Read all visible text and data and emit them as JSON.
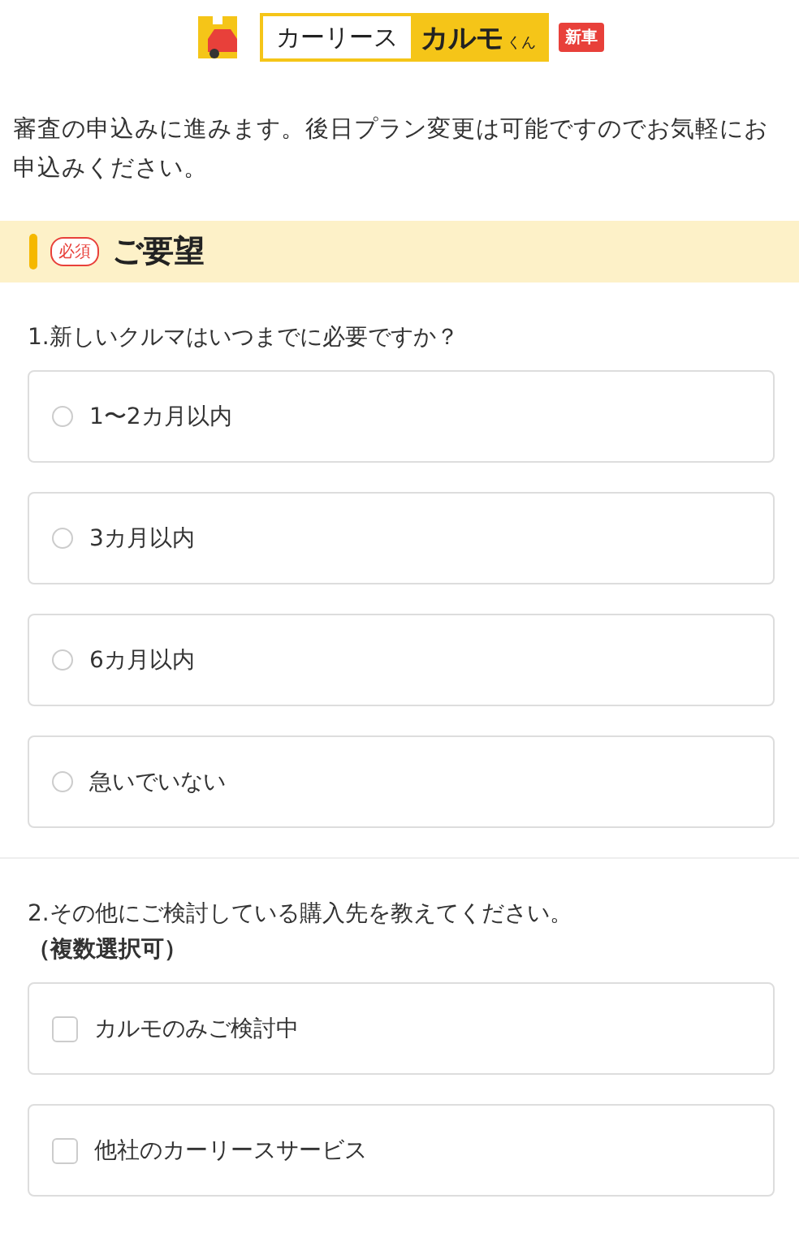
{
  "logo": {
    "lease": "カーリース",
    "brand": "カルモ",
    "brand_suffix": "くん",
    "tag": "新車"
  },
  "intro": "審査の申込みに進みます。後日プラン変更は可能ですのでお気軽にお申込みください。",
  "section": {
    "badge": "必須",
    "title": "ご要望"
  },
  "questions": [
    {
      "kind": "radio",
      "text": "1.新しいクルマはいつまでに必要ですか？",
      "options": [
        {
          "label": "1〜2カ月以内",
          "selected": false
        },
        {
          "label": "3カ月以内",
          "selected": false
        },
        {
          "label": "6カ月以内",
          "selected": false
        },
        {
          "label": "急いでいない",
          "selected": false
        }
      ]
    },
    {
      "kind": "checkbox",
      "text": "2.その他にご検討している購入先を教えてください。",
      "note": "（複数選択可）",
      "options": [
        {
          "label": "カルモのみご検討中",
          "checked": false
        },
        {
          "label": "他社のカーリースサービス",
          "checked": false
        }
      ]
    }
  ]
}
